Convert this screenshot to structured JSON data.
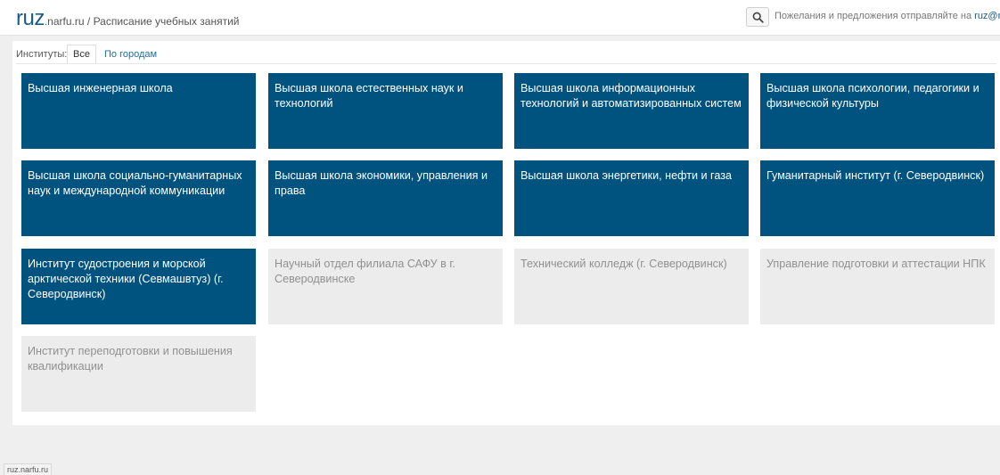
{
  "header": {
    "logo": "ruz",
    "domain": ".narfu.ru",
    "separator": " / ",
    "title": "Расписание учебных занятий",
    "feedback_text": "Пожелания и предложения отправляйте на ",
    "feedback_email": "ruz@narfu.ru"
  },
  "filters": {
    "label": "Институты:",
    "tabs": [
      "Все",
      "По городам"
    ],
    "active_tab": "Все"
  },
  "institutes": [
    {
      "label": "Высшая инженерная школа",
      "active": true
    },
    {
      "label": "Высшая школа естественных наук и технологий",
      "active": true
    },
    {
      "label": "Высшая школа информационных технологий и автоматизированных систем",
      "active": true
    },
    {
      "label": "Высшая школа психологии, педагогики и физической культуры",
      "active": true
    },
    {
      "label": "Высшая школа социально-гуманитарных наук и международной коммуникации",
      "active": true
    },
    {
      "label": "Высшая школа экономики, управления и права",
      "active": true
    },
    {
      "label": "Высшая школа энергетики, нефти и газа",
      "active": true
    },
    {
      "label": "Гуманитарный институт (г. Северодвинск)",
      "active": true
    },
    {
      "label": "Институт судостроения и морской арктической техники (Севмашвтуз) (г. Северодвинск)",
      "active": true
    },
    {
      "label": "Научный отдел филиала САФУ в г. Северодвинске",
      "active": false
    },
    {
      "label": "Технический колледж (г. Северодвинск)",
      "active": false
    },
    {
      "label": "Управление подготовки и аттестации НПК",
      "active": false
    },
    {
      "label": "Институт переподготовки и повышения квалификации",
      "active": false
    }
  ],
  "colors": {
    "tile_active_bg": "#00527f",
    "tile_inactive_bg": "#ececec",
    "brand": "#1a5c86"
  },
  "statusbar": {
    "text": "ruz.narfu.ru"
  }
}
